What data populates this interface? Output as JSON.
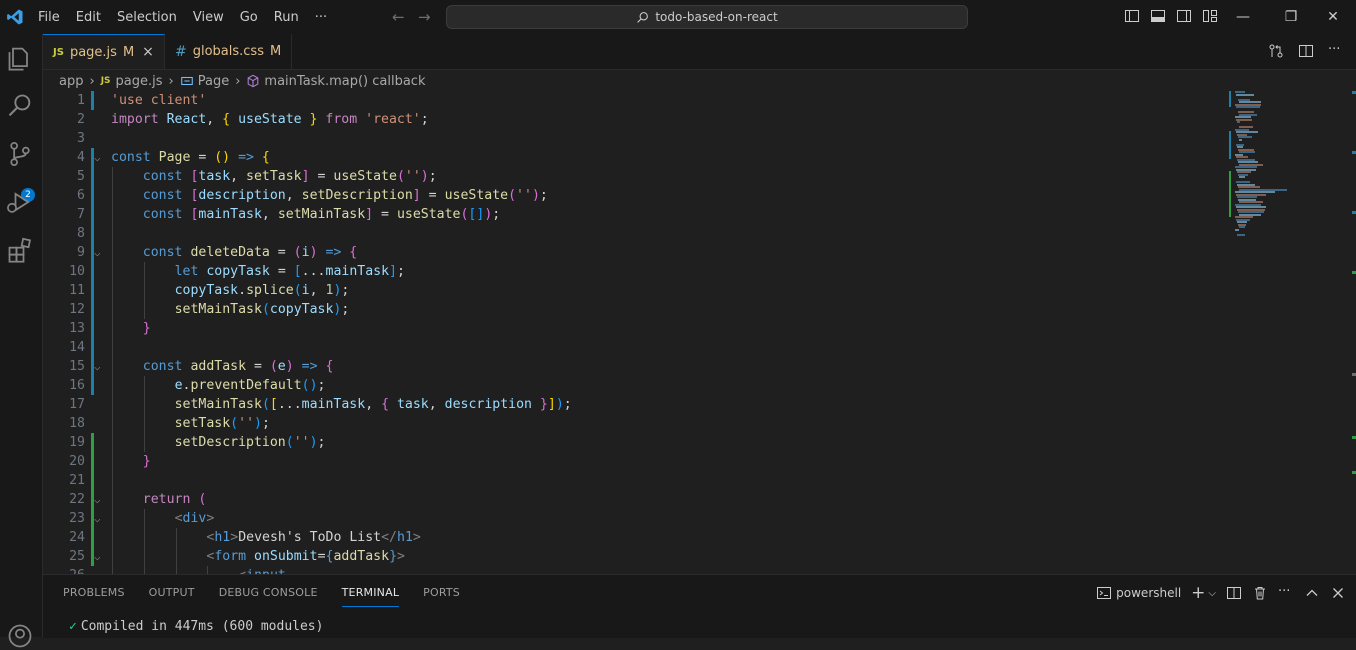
{
  "titlebar": {
    "menu": [
      "File",
      "Edit",
      "Selection",
      "View",
      "Go",
      "Run",
      "···"
    ],
    "search_text": "todo-based-on-react"
  },
  "activity": {
    "scm_badge": "2"
  },
  "tabs": [
    {
      "icon": "JS",
      "name": "page.js",
      "status": "M",
      "close": "×"
    },
    {
      "icon": "#",
      "name": "globals.css",
      "status": "M"
    }
  ],
  "breadcrumb": {
    "folder": "app",
    "file_icon": "JS",
    "file": "page.js",
    "symbol1": "Page",
    "symbol2": "mainTask.map() callback"
  },
  "editor": {
    "lines": [
      {
        "n": "1",
        "ind": 0,
        "parts": [
          [
            "str",
            "'use client'"
          ]
        ]
      },
      {
        "n": "2",
        "ind": 0,
        "parts": [
          [
            "ctl",
            "import "
          ],
          [
            "var",
            "React"
          ],
          [
            "txt",
            ", "
          ],
          [
            "br1",
            "{ "
          ],
          [
            "var",
            "useState "
          ],
          [
            "br1",
            "}"
          ],
          [
            "ctl",
            " from "
          ],
          [
            "str",
            "'react'"
          ],
          [
            "txt",
            ";"
          ]
        ]
      },
      {
        "n": "3",
        "ind": 0,
        "parts": []
      },
      {
        "n": "4",
        "ind": 0,
        "fold": true,
        "parts": [
          [
            "kw",
            "const "
          ],
          [
            "fn",
            "Page"
          ],
          [
            "txt",
            " = "
          ],
          [
            "br1",
            "()"
          ],
          [
            "kw",
            " => "
          ],
          [
            "br1",
            "{"
          ]
        ]
      },
      {
        "n": "5",
        "ind": 1,
        "parts": [
          [
            "kw",
            "const "
          ],
          [
            "br2",
            "["
          ],
          [
            "var",
            "task"
          ],
          [
            "txt",
            ", "
          ],
          [
            "fn",
            "setTask"
          ],
          [
            "br2",
            "]"
          ],
          [
            "txt",
            " = "
          ],
          [
            "fn",
            "useState"
          ],
          [
            "br2",
            "("
          ],
          [
            "str",
            "''"
          ],
          [
            "br2",
            ")"
          ],
          [
            "txt",
            ";"
          ]
        ]
      },
      {
        "n": "6",
        "ind": 1,
        "parts": [
          [
            "kw",
            "const "
          ],
          [
            "br2",
            "["
          ],
          [
            "var",
            "description"
          ],
          [
            "txt",
            ", "
          ],
          [
            "fn",
            "setDescription"
          ],
          [
            "br2",
            "]"
          ],
          [
            "txt",
            " = "
          ],
          [
            "fn",
            "useState"
          ],
          [
            "br2",
            "("
          ],
          [
            "str",
            "''"
          ],
          [
            "br2",
            ")"
          ],
          [
            "txt",
            ";"
          ]
        ]
      },
      {
        "n": "7",
        "ind": 1,
        "parts": [
          [
            "kw",
            "const "
          ],
          [
            "br2",
            "["
          ],
          [
            "var",
            "mainTask"
          ],
          [
            "txt",
            ", "
          ],
          [
            "fn",
            "setMainTask"
          ],
          [
            "br2",
            "]"
          ],
          [
            "txt",
            " = "
          ],
          [
            "fn",
            "useState"
          ],
          [
            "br2",
            "("
          ],
          [
            "br3",
            "[]"
          ],
          [
            "br2",
            ")"
          ],
          [
            "txt",
            ";"
          ]
        ]
      },
      {
        "n": "8",
        "ind": 1,
        "parts": []
      },
      {
        "n": "9",
        "ind": 1,
        "fold": true,
        "parts": [
          [
            "kw",
            "const "
          ],
          [
            "fn",
            "deleteData"
          ],
          [
            "txt",
            " = "
          ],
          [
            "br2",
            "("
          ],
          [
            "var",
            "i"
          ],
          [
            "br2",
            ")"
          ],
          [
            "kw",
            " => "
          ],
          [
            "br2",
            "{"
          ]
        ]
      },
      {
        "n": "10",
        "ind": 2,
        "parts": [
          [
            "kw",
            "let "
          ],
          [
            "var",
            "copyTask"
          ],
          [
            "txt",
            " = "
          ],
          [
            "br3",
            "["
          ],
          [
            "txt",
            "..."
          ],
          [
            "var",
            "mainTask"
          ],
          [
            "br3",
            "]"
          ],
          [
            "txt",
            ";"
          ]
        ]
      },
      {
        "n": "11",
        "ind": 2,
        "parts": [
          [
            "var",
            "copyTask"
          ],
          [
            "txt",
            "."
          ],
          [
            "fn",
            "splice"
          ],
          [
            "br3",
            "("
          ],
          [
            "var",
            "i"
          ],
          [
            "txt",
            ", "
          ],
          [
            "num",
            "1"
          ],
          [
            "br3",
            ")"
          ],
          [
            "txt",
            ";"
          ]
        ]
      },
      {
        "n": "12",
        "ind": 2,
        "parts": [
          [
            "fn",
            "setMainTask"
          ],
          [
            "br3",
            "("
          ],
          [
            "var",
            "copyTask"
          ],
          [
            "br3",
            ")"
          ],
          [
            "txt",
            ";"
          ]
        ]
      },
      {
        "n": "13",
        "ind": 1,
        "parts": [
          [
            "br2",
            "}"
          ]
        ]
      },
      {
        "n": "14",
        "ind": 1,
        "parts": []
      },
      {
        "n": "15",
        "ind": 1,
        "fold": true,
        "parts": [
          [
            "kw",
            "const "
          ],
          [
            "fn",
            "addTask"
          ],
          [
            "txt",
            " = "
          ],
          [
            "br2",
            "("
          ],
          [
            "var",
            "e"
          ],
          [
            "br2",
            ")"
          ],
          [
            "kw",
            " => "
          ],
          [
            "br2",
            "{"
          ]
        ]
      },
      {
        "n": "16",
        "ind": 2,
        "parts": [
          [
            "var",
            "e"
          ],
          [
            "txt",
            "."
          ],
          [
            "fn",
            "preventDefault"
          ],
          [
            "br3",
            "()"
          ],
          [
            "txt",
            ";"
          ]
        ]
      },
      {
        "n": "17",
        "ind": 2,
        "parts": [
          [
            "fn",
            "setMainTask"
          ],
          [
            "br3",
            "("
          ],
          [
            "br1",
            "["
          ],
          [
            "txt",
            "..."
          ],
          [
            "var",
            "mainTask"
          ],
          [
            "txt",
            ", "
          ],
          [
            "br2",
            "{ "
          ],
          [
            "var",
            "task"
          ],
          [
            "txt",
            ", "
          ],
          [
            "var",
            "description "
          ],
          [
            "br2",
            "}"
          ],
          [
            "br1",
            "]"
          ],
          [
            "br3",
            ")"
          ],
          [
            "txt",
            ";"
          ]
        ]
      },
      {
        "n": "18",
        "ind": 2,
        "parts": [
          [
            "fn",
            "setTask"
          ],
          [
            "br3",
            "("
          ],
          [
            "str",
            "''"
          ],
          [
            "br3",
            ")"
          ],
          [
            "txt",
            ";"
          ]
        ]
      },
      {
        "n": "19",
        "ind": 2,
        "parts": [
          [
            "fn",
            "setDescription"
          ],
          [
            "br3",
            "("
          ],
          [
            "str",
            "''"
          ],
          [
            "br3",
            ")"
          ],
          [
            "txt",
            ";"
          ]
        ]
      },
      {
        "n": "20",
        "ind": 1,
        "parts": [
          [
            "br2",
            "}"
          ]
        ]
      },
      {
        "n": "21",
        "ind": 1,
        "parts": []
      },
      {
        "n": "22",
        "ind": 1,
        "fold": true,
        "parts": [
          [
            "ctl",
            "return "
          ],
          [
            "br2",
            "("
          ]
        ]
      },
      {
        "n": "23",
        "ind": 2,
        "fold": true,
        "parts": [
          [
            "ang",
            "<"
          ],
          [
            "tag",
            "div"
          ],
          [
            "ang",
            ">"
          ]
        ]
      },
      {
        "n": "24",
        "ind": 3,
        "parts": [
          [
            "ang",
            "<"
          ],
          [
            "tag",
            "h1"
          ],
          [
            "ang",
            ">"
          ],
          [
            "txt",
            "Devesh's ToDo List"
          ],
          [
            "ang",
            "</"
          ],
          [
            "tag",
            "h1"
          ],
          [
            "ang",
            ">"
          ]
        ]
      },
      {
        "n": "25",
        "ind": 3,
        "fold": true,
        "parts": [
          [
            "ang",
            "<"
          ],
          [
            "tag",
            "form "
          ],
          [
            "var",
            "onSubmit"
          ],
          [
            "txt",
            "="
          ],
          [
            "kw",
            "{"
          ],
          [
            "fn",
            "addTask"
          ],
          [
            "kw",
            "}"
          ],
          [
            "ang",
            ">"
          ]
        ]
      },
      {
        "n": "26",
        "ind": 4,
        "parts": [
          [
            "ang",
            "<"
          ],
          [
            "tag",
            "input"
          ]
        ]
      }
    ]
  },
  "panel": {
    "tabs": [
      "PROBLEMS",
      "OUTPUT",
      "DEBUG CONSOLE",
      "TERMINAL",
      "PORTS"
    ],
    "active_tab": "TERMINAL",
    "shell": "powershell",
    "terminal_check": "✓",
    "terminal_text": "Compiled in 447ms (600 modules)"
  }
}
